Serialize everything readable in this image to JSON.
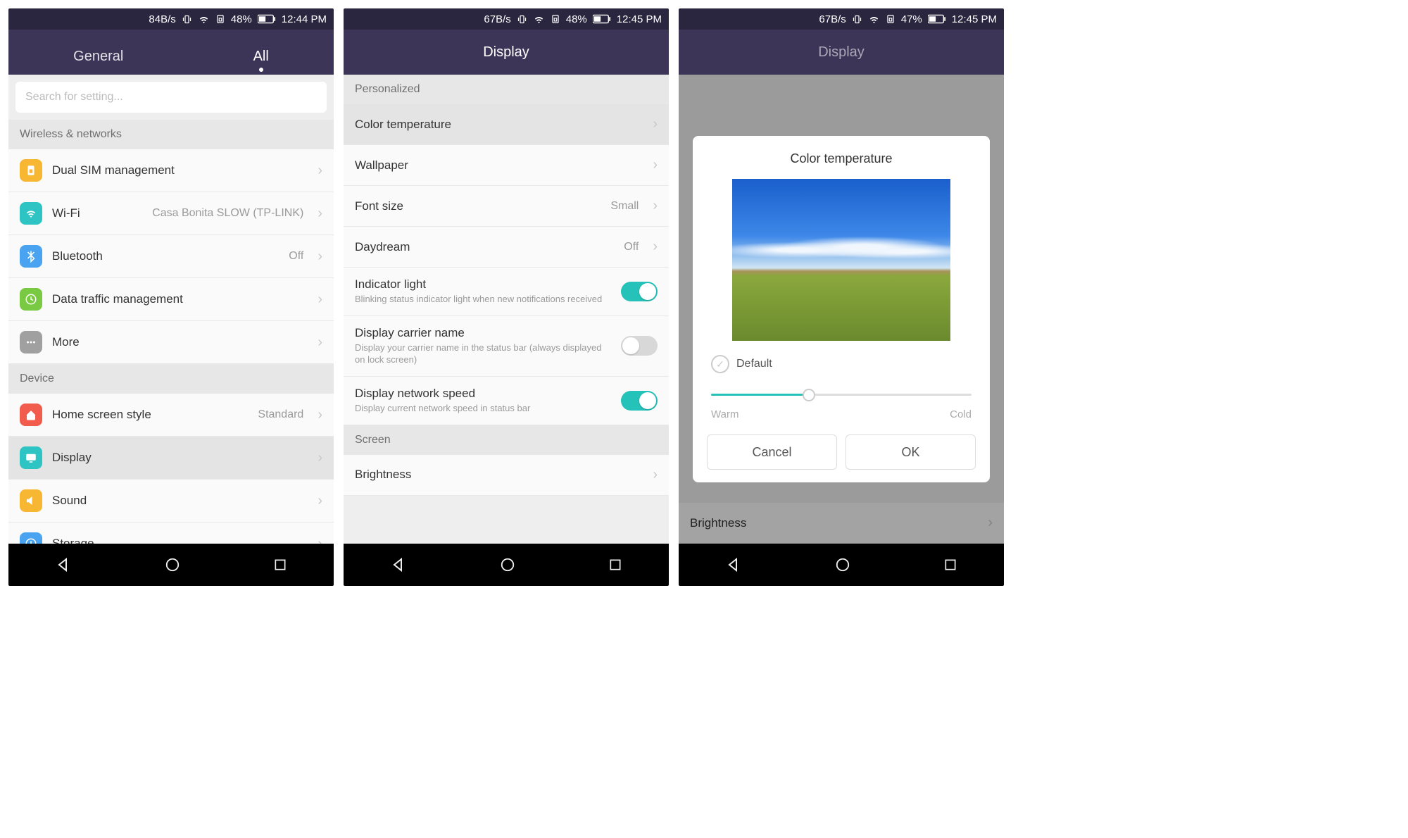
{
  "screen1": {
    "status": {
      "speed": "84B/s",
      "battery": "48%",
      "time": "12:44 PM"
    },
    "tabs": {
      "general": "General",
      "all": "All"
    },
    "search_placeholder": "Search for setting...",
    "sec_wireless": "Wireless & networks",
    "items_wireless": [
      {
        "label": "Dual SIM management",
        "icon_bg": "#f7b733",
        "icon": "sim"
      },
      {
        "label": "Wi-Fi",
        "value": "Casa Bonita SLOW (TP-LINK)",
        "icon_bg": "#2ec4c4",
        "icon": "wifi"
      },
      {
        "label": "Bluetooth",
        "value": "Off",
        "icon_bg": "#4aa3f0",
        "icon": "bt"
      },
      {
        "label": "Data traffic management",
        "icon_bg": "#7ac943",
        "icon": "data"
      },
      {
        "label": "More",
        "icon_bg": "#a0a0a0",
        "icon": "more"
      }
    ],
    "sec_device": "Device",
    "items_device": [
      {
        "label": "Home screen style",
        "value": "Standard",
        "icon_bg": "#f25c4d",
        "icon": "home"
      },
      {
        "label": "Display",
        "icon_bg": "#2ec4c4",
        "icon": "display",
        "selected": true
      },
      {
        "label": "Sound",
        "icon_bg": "#f7b733",
        "icon": "sound"
      },
      {
        "label": "Storage",
        "icon_bg": "#4aa3f0",
        "icon": "storage"
      }
    ]
  },
  "screen2": {
    "status": {
      "speed": "67B/s",
      "battery": "48%",
      "time": "12:45 PM"
    },
    "title": "Display",
    "sec_personalized": "Personalized",
    "rows": [
      {
        "label": "Color temperature",
        "chevron": true,
        "selected": true
      },
      {
        "label": "Wallpaper",
        "chevron": true
      },
      {
        "label": "Font size",
        "value": "Small",
        "chevron": true
      },
      {
        "label": "Daydream",
        "value": "Off",
        "chevron": true
      },
      {
        "label": "Indicator light",
        "sub": "Blinking status indicator light when new notifications received",
        "toggle": "on"
      },
      {
        "label": "Display carrier name",
        "sub": "Display your carrier name in the status bar (always displayed on lock screen)",
        "toggle": "off"
      },
      {
        "label": "Display network speed",
        "sub": "Display current network speed in status bar",
        "toggle": "on"
      }
    ],
    "sec_screen": "Screen",
    "brightness": "Brightness"
  },
  "screen3": {
    "status": {
      "speed": "67B/s",
      "battery": "47%",
      "time": "12:45 PM"
    },
    "title": "Display",
    "dialog": {
      "title": "Color temperature",
      "default_label": "Default",
      "warm": "Warm",
      "cold": "Cold",
      "cancel": "Cancel",
      "ok": "OK"
    },
    "brightness": "Brightness"
  }
}
